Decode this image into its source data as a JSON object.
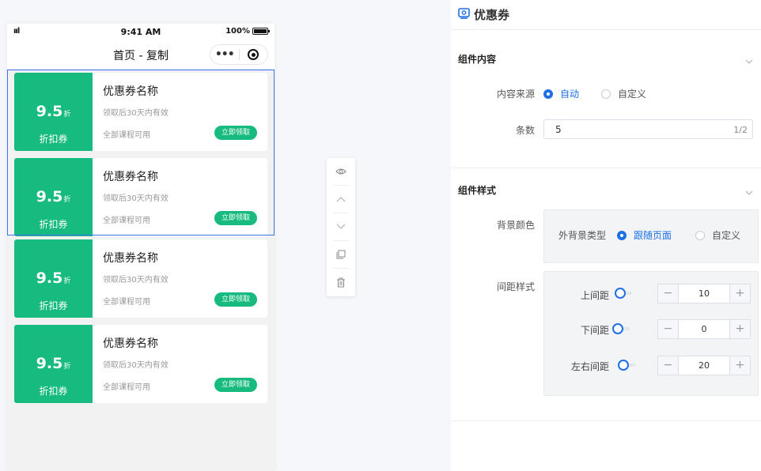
{
  "phone": {
    "status": {
      "signal": "ııl",
      "time": "9:41 AM",
      "battery": "100%"
    },
    "nav": {
      "title": "首页 - 复制",
      "menu_dots": "•••"
    },
    "coupons": [
      {
        "value": "9.5",
        "unit": "折",
        "type": "折扣券",
        "name": "优惠券名称",
        "validity": "领取后30天内有效",
        "scope": "全部课程可用",
        "button": "立即领取"
      },
      {
        "value": "9.5",
        "unit": "折",
        "type": "折扣券",
        "name": "优惠券名称",
        "validity": "领取后30天内有效",
        "scope": "全部课程可用",
        "button": "立即领取"
      },
      {
        "value": "9.5",
        "unit": "折",
        "type": "折扣券",
        "name": "优惠券名称",
        "validity": "领取后30天内有效",
        "scope": "全部课程可用",
        "button": "立即领取"
      },
      {
        "value": "9.5",
        "unit": "折",
        "type": "折扣券",
        "name": "优惠券名称",
        "validity": "领取后30天内有效",
        "scope": "全部课程可用",
        "button": "立即领取"
      }
    ]
  },
  "toolbar": {
    "tools": [
      "eye-icon",
      "arrow-up-icon",
      "arrow-down-icon",
      "copy-icon",
      "trash-icon"
    ]
  },
  "panel": {
    "title": "优惠券",
    "content_section": {
      "title": "组件内容",
      "source_label": "内容来源",
      "source_options": [
        "自动",
        "自定义"
      ],
      "source_selected": "自动",
      "count_label": "条数",
      "count_value": "5",
      "count_limit": "1/2"
    },
    "style_section": {
      "title": "组件样式",
      "bg_label": "背景颜色",
      "bg_type_label": "外背景类型",
      "bg_options": [
        "跟随页面",
        "自定义"
      ],
      "bg_selected": "跟随页面",
      "spacing_label": "间距样式",
      "spacing": [
        {
          "label": "上间距",
          "value": "10",
          "minus": "−",
          "plus": "+"
        },
        {
          "label": "下间距",
          "value": "0",
          "minus": "−",
          "plus": "+"
        },
        {
          "label": "左右间距",
          "value": "20",
          "minus": "−",
          "plus": "+"
        }
      ]
    }
  },
  "colors": {
    "accent": "#1e6fe8",
    "coupon_green": "#17bb7f"
  }
}
